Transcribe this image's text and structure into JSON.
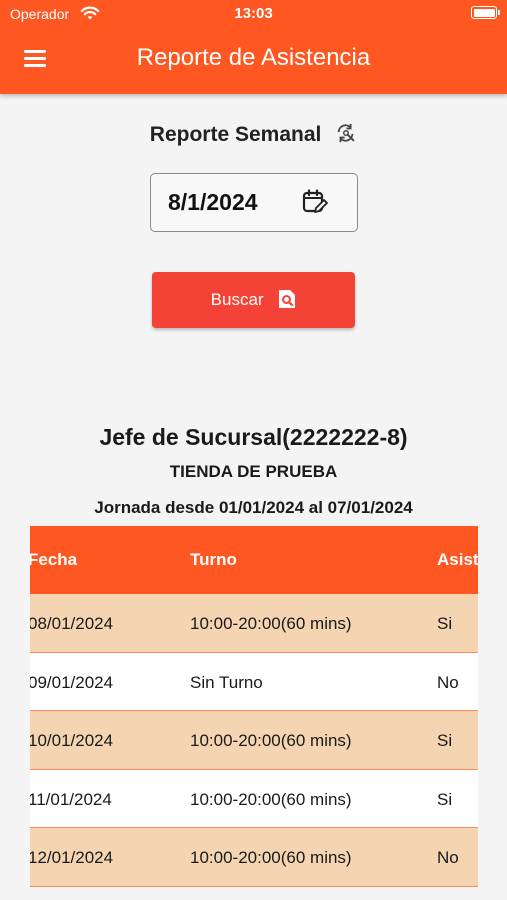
{
  "status_bar": {
    "carrier": "Operador",
    "time": "13:03"
  },
  "app_bar": {
    "title": "Reporte de Asistencia"
  },
  "report": {
    "heading": "Reporte Semanal",
    "date_value": "8/1/2024",
    "search_label": "Buscar"
  },
  "summary": {
    "employee": "Jefe de Sucursal(2222222-8)",
    "store": "TIENDA DE PRUEBA",
    "range": "Jornada desde 01/01/2024 al 07/01/2024"
  },
  "table": {
    "columns": [
      "Fecha",
      "Turno",
      "Asistencia"
    ],
    "rows": [
      {
        "fecha": "08/01/2024",
        "turno": "10:00-20:00(60 mins)",
        "asistencia": "Si"
      },
      {
        "fecha": "09/01/2024",
        "turno": "Sin Turno",
        "asistencia": "No"
      },
      {
        "fecha": "10/01/2024",
        "turno": "10:00-20:00(60 mins)",
        "asistencia": "Si"
      },
      {
        "fecha": "11/01/2024",
        "turno": "10:00-20:00(60 mins)",
        "asistencia": "Si"
      },
      {
        "fecha": "12/01/2024",
        "turno": "10:00-20:00(60 mins)",
        "asistencia": "No"
      }
    ]
  },
  "colors": {
    "primary": "#ff5722",
    "button": "#f44336",
    "row_highlight": "#f5d4b1"
  },
  "icons": {
    "menu": "menu-icon",
    "refresh": "refresh-search-icon",
    "calendar": "calendar-edit-icon",
    "search": "search-document-icon",
    "wifi": "wifi-icon",
    "battery": "battery-icon"
  }
}
